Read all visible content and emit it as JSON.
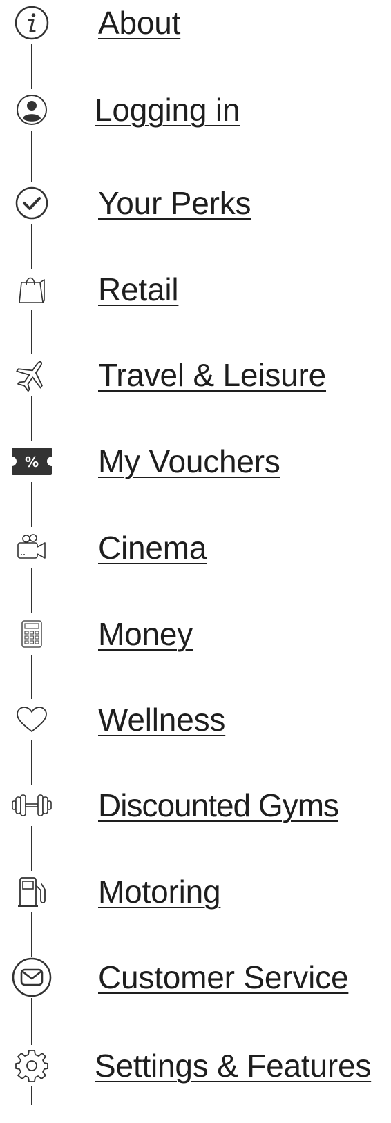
{
  "menu": {
    "items": [
      {
        "label": "About",
        "icon": "info-icon"
      },
      {
        "label": "Logging in",
        "icon": "user-icon"
      },
      {
        "label": "Your Perks",
        "icon": "check-circle-icon"
      },
      {
        "label": "Retail",
        "icon": "shopping-bag-icon"
      },
      {
        "label": "Travel & Leisure",
        "icon": "airplane-icon"
      },
      {
        "label": "My Vouchers",
        "icon": "voucher-ticket-icon"
      },
      {
        "label": "Cinema",
        "icon": "movie-camera-icon"
      },
      {
        "label": "Money",
        "icon": "calculator-icon"
      },
      {
        "label": "Wellness",
        "icon": "heart-icon"
      },
      {
        "label": "Discounted Gyms",
        "icon": "dumbbell-icon"
      },
      {
        "label": "Motoring",
        "icon": "fuel-pump-icon"
      },
      {
        "label": "Customer Service",
        "icon": "envelope-icon"
      },
      {
        "label": "Settings & Features",
        "icon": "gear-icon"
      }
    ],
    "voucher_symbol": "%"
  }
}
